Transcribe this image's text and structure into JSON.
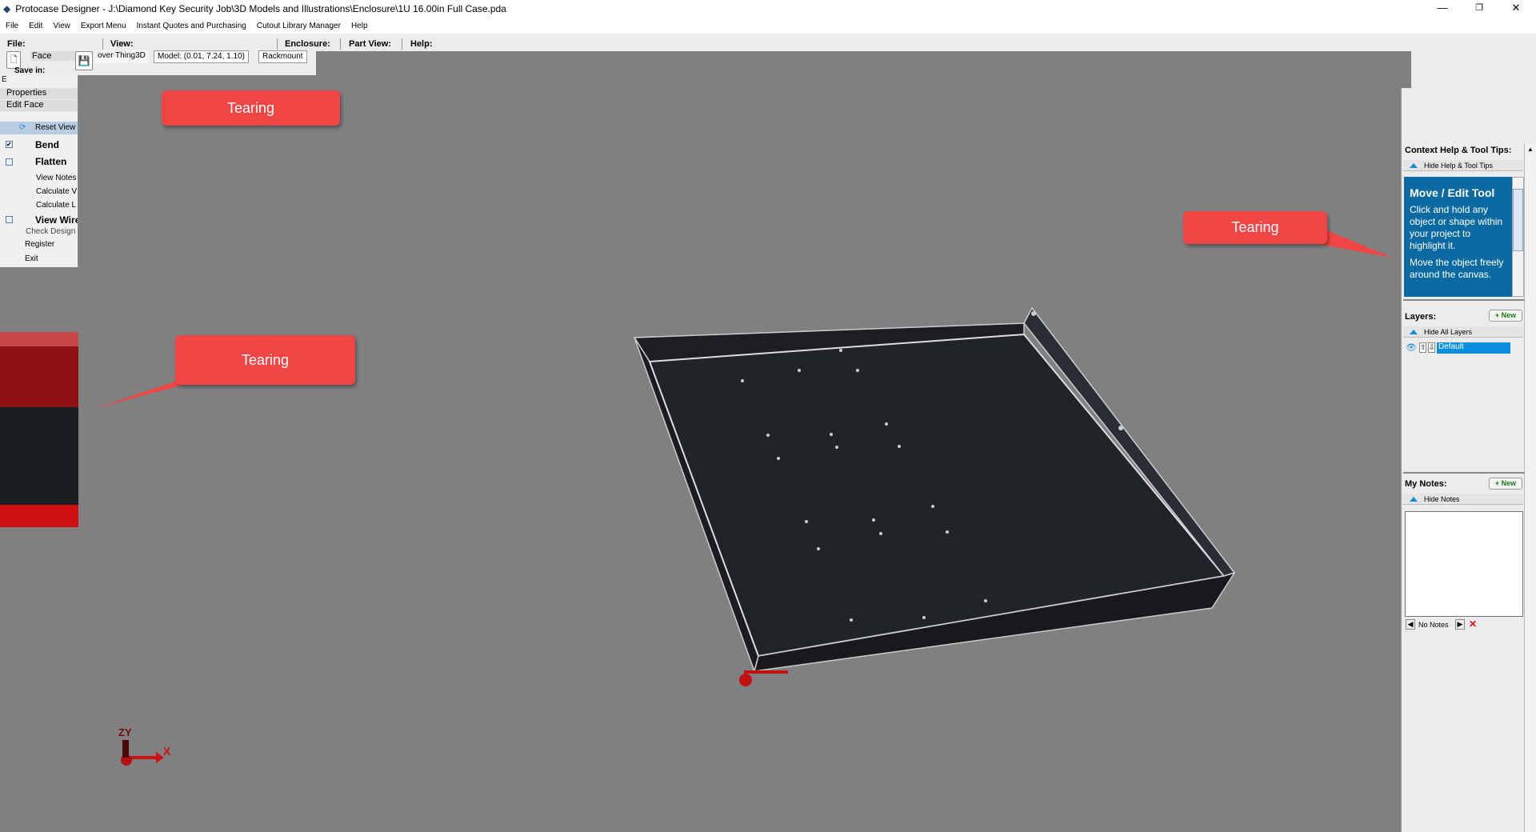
{
  "window": {
    "title": "Protocase Designer - J:\\Diamond Key Security Job\\3D Models and Illustrations\\Enclosure\\1U 16.00in Full Case.pda",
    "minimize": "—",
    "restore": "❐",
    "close": "✕"
  },
  "menu": [
    "File",
    "Edit",
    "View",
    "Export Menu",
    "Instant Quotes and Purchasing",
    "Cutout Library Manager",
    "Help"
  ],
  "toolbar": {
    "file": "File:",
    "view": "View:",
    "enclosure": "Enclosure:",
    "part_view": "Part View:",
    "help": "Help:",
    "face": "Face",
    "save_in": "Save in:",
    "hover": "over Thing3D",
    "model": "Model: (0.01, 7.24, 1.10)",
    "type": "Rackmount"
  },
  "left_menu": {
    "e": "E",
    "properties": "Properties",
    "edit_face": "Edit Face",
    "reset_view": "Reset View",
    "bend": "Bend",
    "bend_checked": true,
    "flatten": "Flatten",
    "view_notes": "View Notes",
    "calc_w": "Calculate V",
    "calc_l": "Calculate L",
    "view_wire": "View Wire",
    "check_design": "Check Design",
    "register": "Register",
    "exit": "Exit"
  },
  "callouts": [
    "Tearing",
    "Tearing",
    "Tearing"
  ],
  "right_panel": {
    "help_title": "Context Help & Tool Tips:",
    "hide_help": "Hide Help & Tool Tips",
    "tip_title": "Move / Edit Tool",
    "tip_p1": "Click and hold any object or shape within your project to highlight it.",
    "tip_p2": "Move the object freely around the canvas.",
    "layers_title": "Layers:",
    "new": "+ New",
    "hide_layers": "Hide All Layers",
    "layer_name": "Default",
    "notes_title": "My Notes:",
    "hide_notes": "Hide Notes",
    "no_notes": "No Notes"
  },
  "axes": {
    "x": "X",
    "zy": "ZY"
  },
  "colors": {
    "canvas": "#808080",
    "tip_bg": "#0a6aa1",
    "callout": "#f24545",
    "layer_sel": "#0a8ee0"
  }
}
